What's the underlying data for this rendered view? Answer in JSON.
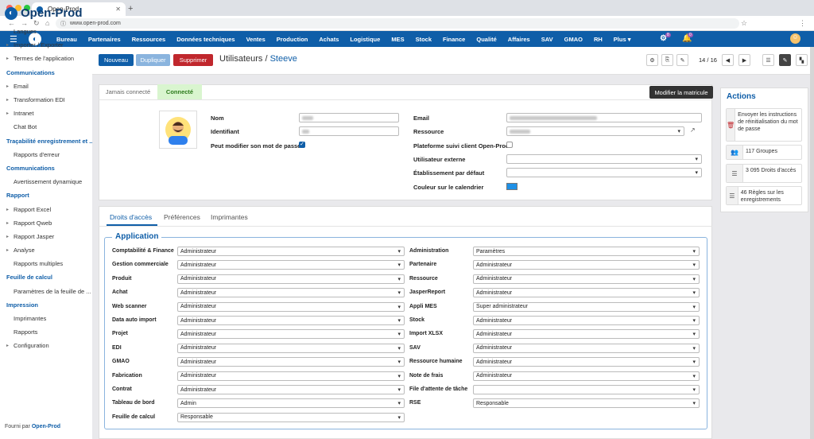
{
  "browser": {
    "tab_title": "Open-Prod",
    "url": "www.open-prod.com"
  },
  "topnav": {
    "menus": [
      "Bureau",
      "Partenaires",
      "Ressources",
      "Données techniques",
      "Ventes",
      "Production",
      "Achats",
      "Logistique",
      "MES",
      "Stock",
      "Finance",
      "Qualité",
      "Affaires",
      "SAV",
      "GMAO",
      "RH",
      "Plus ▾"
    ],
    "activity_count": "8",
    "notification_count": "0"
  },
  "sidebar": {
    "brand": "Open-Prod",
    "items": [
      {
        "label": "Langues",
        "type": "sub",
        "caret": false
      },
      {
        "label": "Importer / Exporter",
        "type": "sub",
        "caret": true
      },
      {
        "label": "Termes de l'application",
        "type": "sub",
        "caret": true
      },
      {
        "label": "Communications",
        "type": "sec"
      },
      {
        "label": "Email",
        "type": "sub",
        "caret": true
      },
      {
        "label": "Transformation EDI",
        "type": "sub",
        "caret": true
      },
      {
        "label": "Intranet",
        "type": "sub",
        "caret": true
      },
      {
        "label": "Chat Bot",
        "type": "sub",
        "caret": false
      },
      {
        "label": "Traçabilité enregistrement et ...",
        "type": "sec"
      },
      {
        "label": "Rapports d'erreur",
        "type": "sub",
        "caret": false
      },
      {
        "label": "Communications",
        "type": "sec"
      },
      {
        "label": "Avertissement dynamique",
        "type": "sub",
        "caret": false
      },
      {
        "label": "Rapport",
        "type": "sec"
      },
      {
        "label": "Rapport Excel",
        "type": "sub",
        "caret": true
      },
      {
        "label": "Rapport Qweb",
        "type": "sub",
        "caret": true
      },
      {
        "label": "Rapport Jasper",
        "type": "sub",
        "caret": true
      },
      {
        "label": "Analyse",
        "type": "sub",
        "caret": true
      },
      {
        "label": "Rapports multiples",
        "type": "sub",
        "caret": false
      },
      {
        "label": "Feuille de calcul",
        "type": "sec"
      },
      {
        "label": "Paramètres de la feuille de ...",
        "type": "sub",
        "caret": false
      },
      {
        "label": "Impression",
        "type": "sec"
      },
      {
        "label": "Imprimantes",
        "type": "sub",
        "caret": false
      },
      {
        "label": "Rapports",
        "type": "sub",
        "caret": false
      },
      {
        "label": "Configuration",
        "type": "sub",
        "caret": true
      }
    ],
    "footer_prefix": "Fourni par",
    "footer_brand": "Open-Prod"
  },
  "controlpanel": {
    "new_label": "Nouveau",
    "duplicate_label": "Dupliquer",
    "delete_label": "Supprimer",
    "breadcrumb_parent": "Utilisateurs",
    "breadcrumb_sep": "/",
    "breadcrumb_current": "Steeve",
    "pager": "14 / 16"
  },
  "status": {
    "stage1": "Jamais connecté",
    "stage2": "Connecté",
    "modify_button": "Modifier la matricule"
  },
  "form": {
    "nom_label": "Nom",
    "identifiant_label": "Identifiant",
    "pwd_label": "Peut modifier son mot de passe",
    "email_label": "Email",
    "ressource_label": "Ressource",
    "plateforme_label": "Plateforme suivi client Open-Prod",
    "externe_label": "Utilisateur externe",
    "etablissement_label": "Établissement par défaut",
    "couleur_label": "Couleur sur le calendrier",
    "calendar_color": "#1e90e6"
  },
  "notebook": {
    "tabs": [
      "Droits d'accès",
      "Préférences",
      "Imprimantes"
    ],
    "group_title": "Application",
    "left_rows": [
      {
        "label": "Comptabilité & Finance",
        "value": "Administrateur"
      },
      {
        "label": "Gestion commerciale",
        "value": "Administrateur"
      },
      {
        "label": "Produit",
        "value": "Administrateur"
      },
      {
        "label": "Achat",
        "value": "Administrateur"
      },
      {
        "label": "Web scanner",
        "value": "Administrateur"
      },
      {
        "label": "Data auto import",
        "value": "Administrateur"
      },
      {
        "label": "Projet",
        "value": "Administrateur"
      },
      {
        "label": "EDI",
        "value": "Administrateur"
      },
      {
        "label": "GMAO",
        "value": "Administrateur"
      },
      {
        "label": "Fabrication",
        "value": "Administrateur"
      },
      {
        "label": "Contrat",
        "value": "Administrateur"
      },
      {
        "label": "Tableau de bord",
        "value": "Admin"
      },
      {
        "label": "Feuille de calcul",
        "value": "Responsable"
      }
    ],
    "right_rows": [
      {
        "label": "Administration",
        "value": "Paramètres"
      },
      {
        "label": "Partenaire",
        "value": "Administrateur"
      },
      {
        "label": "Ressource",
        "value": "Administrateur"
      },
      {
        "label": "JasperReport",
        "value": "Administrateur"
      },
      {
        "label": "Appli MES",
        "value": "Super administrateur"
      },
      {
        "label": "Stock",
        "value": "Administrateur"
      },
      {
        "label": "Import XLSX",
        "value": "Administrateur"
      },
      {
        "label": "SAV",
        "value": "Administrateur"
      },
      {
        "label": "Ressource humaine",
        "value": "Administrateur"
      },
      {
        "label": "Note de frais",
        "value": "Administrateur"
      },
      {
        "label": "File d'attente de tâche",
        "value": ""
      },
      {
        "label": "RSE",
        "value": "Responsable"
      }
    ]
  },
  "actions": {
    "title": "Actions",
    "items": [
      {
        "icon": "trash-icon",
        "label": "Envoyer les instructions de réinitialisation du mot de passe"
      },
      {
        "icon": "users-icon",
        "label": "117 Groupes"
      },
      {
        "icon": "list-icon",
        "label": "3 095 Droits d'accès"
      },
      {
        "icon": "list-icon",
        "label": "46 Règles sur les enregistrements"
      }
    ]
  }
}
